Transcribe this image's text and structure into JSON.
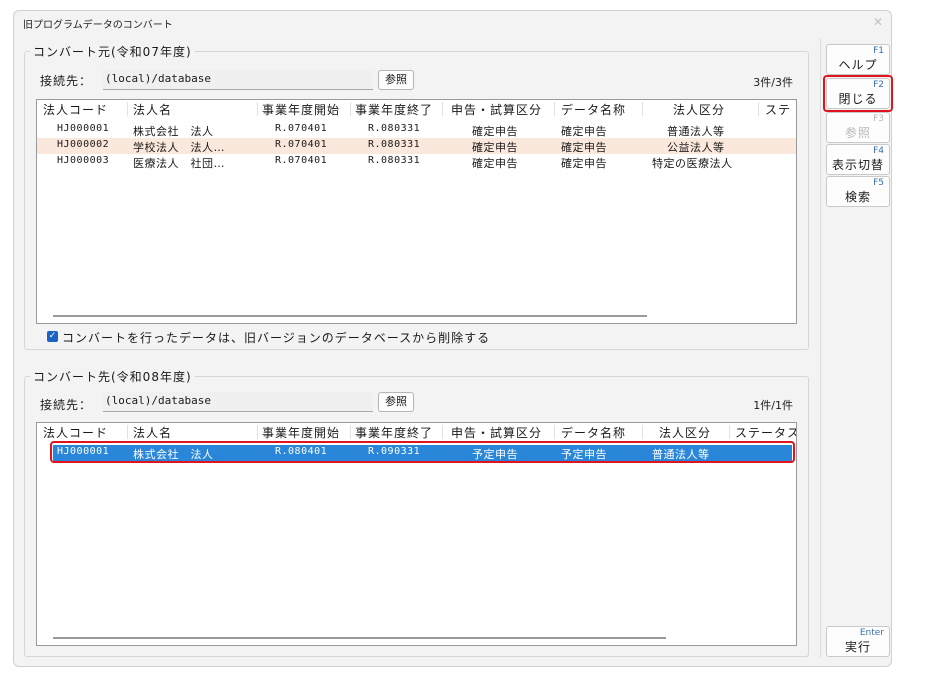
{
  "window": {
    "title": "旧プログラムデータのコンバート",
    "close": "✕"
  },
  "source": {
    "legend": "コンバート元(令和07年度)",
    "conn_label": "接続先：",
    "conn_value": "(local)/database",
    "browse": "参照",
    "count": "3件/3件",
    "headers": [
      "法人コード",
      "法人名",
      "事業年度開始",
      "事業年度終了",
      "申告・試算区分",
      "データ名称",
      "法人区分",
      "ステ"
    ],
    "rows": [
      {
        "code": "HJ000001",
        "name": "株式会社　法人",
        "start": "R.070401",
        "end": "R.080331",
        "kind": "確定申告",
        "data": "確定申告",
        "corp": "普通法人等",
        "status": ""
      },
      {
        "code": "HJ000002",
        "name": "学校法人　法人…",
        "start": "R.070401",
        "end": "R.080331",
        "kind": "確定申告",
        "data": "確定申告",
        "corp": "公益法人等",
        "status": ""
      },
      {
        "code": "HJ000003",
        "name": "医療法人　社団…",
        "start": "R.070401",
        "end": "R.080331",
        "kind": "確定申告",
        "data": "確定申告",
        "corp": "特定の医療法人",
        "status": ""
      }
    ],
    "checkbox_label": "コンバートを行ったデータは、旧バージョンのデータベースから削除する",
    "checkbox_checked": true
  },
  "dest": {
    "legend": "コンバート先(令和08年度)",
    "conn_label": "接続先：",
    "conn_value": "(local)/database",
    "browse": "参照",
    "count": "1件/1件",
    "headers": [
      "法人コード",
      "法人名",
      "事業年度開始",
      "事業年度終了",
      "申告・試算区分",
      "データ名称",
      "法人区分",
      "ステータス"
    ],
    "rows": [
      {
        "code": "HJ000001",
        "name": "株式会社　法人",
        "start": "R.080401",
        "end": "R.090331",
        "kind": "予定申告",
        "data": "予定申告",
        "corp": "普通法人等",
        "status": ""
      }
    ]
  },
  "fkeys": [
    {
      "key": "F1",
      "label": "ヘルプ",
      "enabled": true
    },
    {
      "key": "F2",
      "label": "閉じる",
      "enabled": true
    },
    {
      "key": "F3",
      "label": "参照",
      "enabled": false
    },
    {
      "key": "F4",
      "label": "表示切替",
      "enabled": true
    },
    {
      "key": "F5",
      "label": "検索",
      "enabled": true
    }
  ],
  "execute": {
    "key": "Enter",
    "label": "実行"
  },
  "colors": {
    "selection": "#2a86d8",
    "alt_row": "#fbe8dc",
    "highlight": "#e0141e",
    "checkbox": "#1a63c4"
  }
}
